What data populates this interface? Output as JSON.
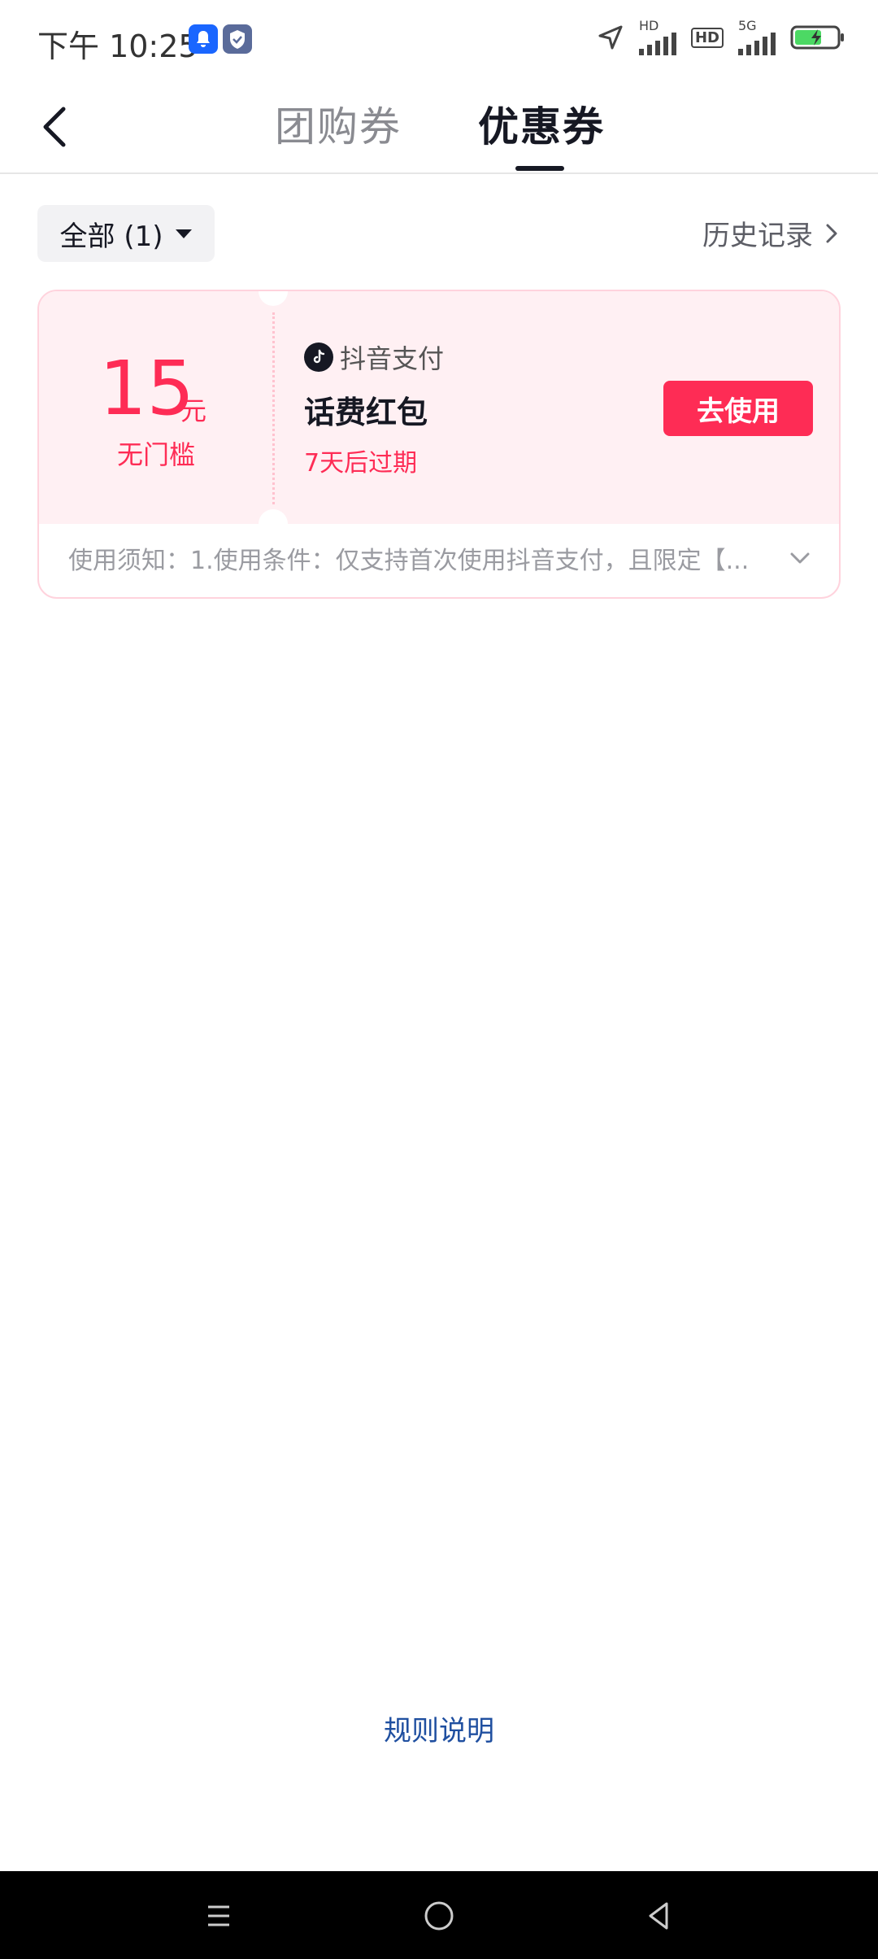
{
  "status_bar": {
    "time": "下午 10:25",
    "indicators": [
      "HD",
      "HD",
      "5G"
    ],
    "icons": [
      "bell-icon",
      "shield-check-icon",
      "location-arrow-icon",
      "signal-icon",
      "battery-charging-icon"
    ]
  },
  "header": {
    "tabs": [
      {
        "label": "团购券",
        "active": false
      },
      {
        "label": "优惠券",
        "active": true
      }
    ]
  },
  "filter": {
    "label": "全部 (1)",
    "history_label": "历史记录"
  },
  "coupon": {
    "amount": "15",
    "unit": "元",
    "threshold": "无门槛",
    "brand": "抖音支付",
    "name": "话费红包",
    "expiry": "7天后过期",
    "button_label": "去使用",
    "notice": "使用须知：1.使用条件：仅支持首次使用抖音支付，且限定【..."
  },
  "footer": {
    "rules_label": "规则说明"
  },
  "colors": {
    "accent": "#fe2c55",
    "coupon_bg": "#fff0f3",
    "link": "#1f4fa0"
  }
}
